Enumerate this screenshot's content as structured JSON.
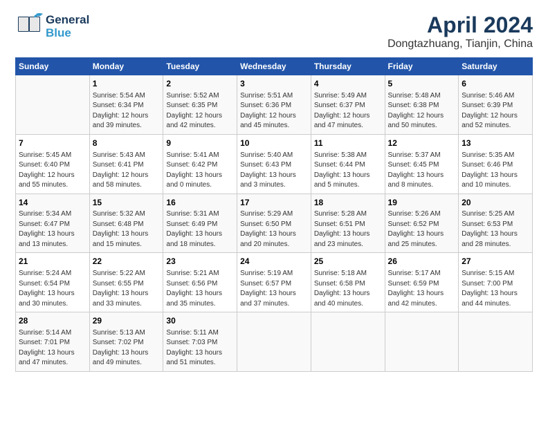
{
  "header": {
    "logo_line1": "General",
    "logo_line2": "Blue",
    "title": "April 2024",
    "subtitle": "Dongtazhuang, Tianjin, China"
  },
  "weekdays": [
    "Sunday",
    "Monday",
    "Tuesday",
    "Wednesday",
    "Thursday",
    "Friday",
    "Saturday"
  ],
  "weeks": [
    [
      {
        "day": "",
        "info": ""
      },
      {
        "day": "1",
        "info": "Sunrise: 5:54 AM\nSunset: 6:34 PM\nDaylight: 12 hours\nand 39 minutes."
      },
      {
        "day": "2",
        "info": "Sunrise: 5:52 AM\nSunset: 6:35 PM\nDaylight: 12 hours\nand 42 minutes."
      },
      {
        "day": "3",
        "info": "Sunrise: 5:51 AM\nSunset: 6:36 PM\nDaylight: 12 hours\nand 45 minutes."
      },
      {
        "day": "4",
        "info": "Sunrise: 5:49 AM\nSunset: 6:37 PM\nDaylight: 12 hours\nand 47 minutes."
      },
      {
        "day": "5",
        "info": "Sunrise: 5:48 AM\nSunset: 6:38 PM\nDaylight: 12 hours\nand 50 minutes."
      },
      {
        "day": "6",
        "info": "Sunrise: 5:46 AM\nSunset: 6:39 PM\nDaylight: 12 hours\nand 52 minutes."
      }
    ],
    [
      {
        "day": "7",
        "info": "Sunrise: 5:45 AM\nSunset: 6:40 PM\nDaylight: 12 hours\nand 55 minutes."
      },
      {
        "day": "8",
        "info": "Sunrise: 5:43 AM\nSunset: 6:41 PM\nDaylight: 12 hours\nand 58 minutes."
      },
      {
        "day": "9",
        "info": "Sunrise: 5:41 AM\nSunset: 6:42 PM\nDaylight: 13 hours\nand 0 minutes."
      },
      {
        "day": "10",
        "info": "Sunrise: 5:40 AM\nSunset: 6:43 PM\nDaylight: 13 hours\nand 3 minutes."
      },
      {
        "day": "11",
        "info": "Sunrise: 5:38 AM\nSunset: 6:44 PM\nDaylight: 13 hours\nand 5 minutes."
      },
      {
        "day": "12",
        "info": "Sunrise: 5:37 AM\nSunset: 6:45 PM\nDaylight: 13 hours\nand 8 minutes."
      },
      {
        "day": "13",
        "info": "Sunrise: 5:35 AM\nSunset: 6:46 PM\nDaylight: 13 hours\nand 10 minutes."
      }
    ],
    [
      {
        "day": "14",
        "info": "Sunrise: 5:34 AM\nSunset: 6:47 PM\nDaylight: 13 hours\nand 13 minutes."
      },
      {
        "day": "15",
        "info": "Sunrise: 5:32 AM\nSunset: 6:48 PM\nDaylight: 13 hours\nand 15 minutes."
      },
      {
        "day": "16",
        "info": "Sunrise: 5:31 AM\nSunset: 6:49 PM\nDaylight: 13 hours\nand 18 minutes."
      },
      {
        "day": "17",
        "info": "Sunrise: 5:29 AM\nSunset: 6:50 PM\nDaylight: 13 hours\nand 20 minutes."
      },
      {
        "day": "18",
        "info": "Sunrise: 5:28 AM\nSunset: 6:51 PM\nDaylight: 13 hours\nand 23 minutes."
      },
      {
        "day": "19",
        "info": "Sunrise: 5:26 AM\nSunset: 6:52 PM\nDaylight: 13 hours\nand 25 minutes."
      },
      {
        "day": "20",
        "info": "Sunrise: 5:25 AM\nSunset: 6:53 PM\nDaylight: 13 hours\nand 28 minutes."
      }
    ],
    [
      {
        "day": "21",
        "info": "Sunrise: 5:24 AM\nSunset: 6:54 PM\nDaylight: 13 hours\nand 30 minutes."
      },
      {
        "day": "22",
        "info": "Sunrise: 5:22 AM\nSunset: 6:55 PM\nDaylight: 13 hours\nand 33 minutes."
      },
      {
        "day": "23",
        "info": "Sunrise: 5:21 AM\nSunset: 6:56 PM\nDaylight: 13 hours\nand 35 minutes."
      },
      {
        "day": "24",
        "info": "Sunrise: 5:19 AM\nSunset: 6:57 PM\nDaylight: 13 hours\nand 37 minutes."
      },
      {
        "day": "25",
        "info": "Sunrise: 5:18 AM\nSunset: 6:58 PM\nDaylight: 13 hours\nand 40 minutes."
      },
      {
        "day": "26",
        "info": "Sunrise: 5:17 AM\nSunset: 6:59 PM\nDaylight: 13 hours\nand 42 minutes."
      },
      {
        "day": "27",
        "info": "Sunrise: 5:15 AM\nSunset: 7:00 PM\nDaylight: 13 hours\nand 44 minutes."
      }
    ],
    [
      {
        "day": "28",
        "info": "Sunrise: 5:14 AM\nSunset: 7:01 PM\nDaylight: 13 hours\nand 47 minutes."
      },
      {
        "day": "29",
        "info": "Sunrise: 5:13 AM\nSunset: 7:02 PM\nDaylight: 13 hours\nand 49 minutes."
      },
      {
        "day": "30",
        "info": "Sunrise: 5:11 AM\nSunset: 7:03 PM\nDaylight: 13 hours\nand 51 minutes."
      },
      {
        "day": "",
        "info": ""
      },
      {
        "day": "",
        "info": ""
      },
      {
        "day": "",
        "info": ""
      },
      {
        "day": "",
        "info": ""
      }
    ]
  ]
}
